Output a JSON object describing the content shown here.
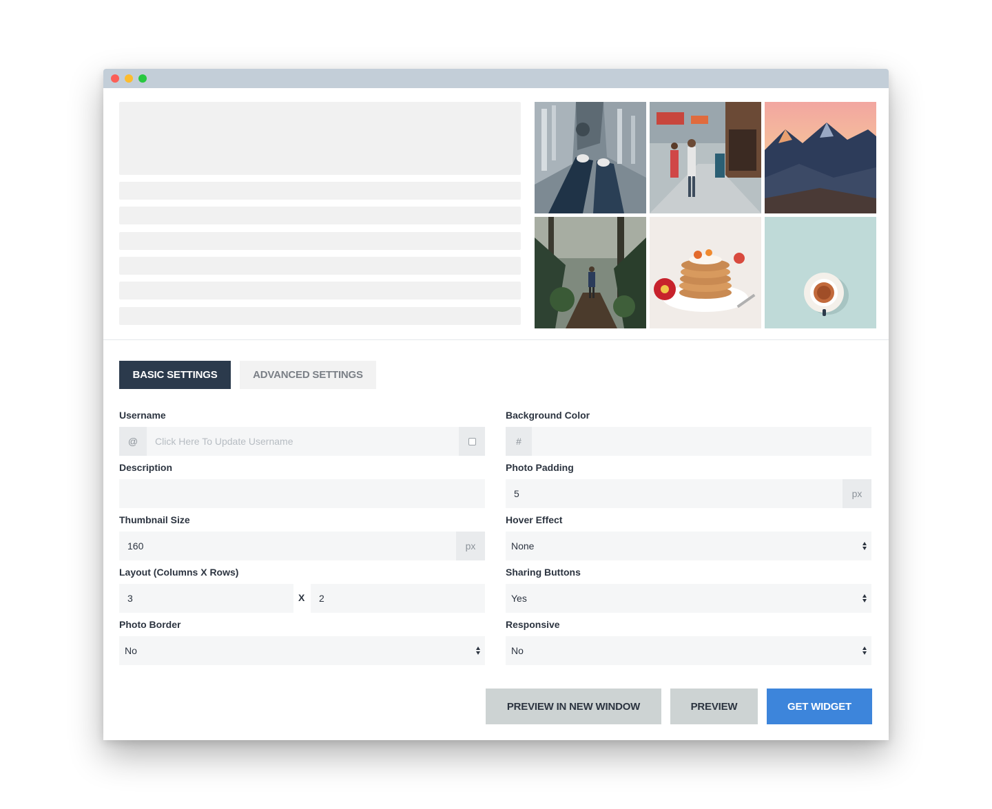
{
  "window": {
    "traffic_lights": [
      "close",
      "minimize",
      "maximize"
    ]
  },
  "gallery": {
    "photos": [
      "city-rooftop-photo",
      "street-market-photo",
      "mountain-sunset-photo",
      "forest-hiker-photo",
      "pancakes-photo",
      "coffee-cup-photo"
    ]
  },
  "tabs": {
    "basic": "BASIC SETTINGS",
    "advanced": "ADVANCED SETTINGS"
  },
  "form": {
    "username": {
      "label": "Username",
      "prefix": "@",
      "placeholder": "Click Here To Update Username",
      "value": ""
    },
    "description": {
      "label": "Description",
      "value": ""
    },
    "thumbnail_size": {
      "label": "Thumbnail Size",
      "value": "160",
      "unit": "px"
    },
    "layout": {
      "label": "Layout (Columns X Rows)",
      "columns": "3",
      "separator": "X",
      "rows": "2"
    },
    "photo_border": {
      "label": "Photo Border",
      "value": "No"
    },
    "background_color": {
      "label": "Background Color",
      "prefix": "#",
      "value": ""
    },
    "photo_padding": {
      "label": "Photo Padding",
      "value": "5",
      "unit": "px"
    },
    "hover_effect": {
      "label": "Hover Effect",
      "value": "None"
    },
    "sharing_buttons": {
      "label": "Sharing Buttons",
      "value": "Yes"
    },
    "responsive": {
      "label": "Responsive",
      "value": "No"
    }
  },
  "buttons": {
    "preview_new_window": "PREVIEW IN NEW WINDOW",
    "preview": "PREVIEW",
    "get_widget": "GET WIDGET"
  },
  "colors": {
    "tab_active": "#2b3a4c",
    "primary_button": "#3d85db",
    "secondary_button": "#cdd3d3",
    "titlebar": "#c3ced8"
  }
}
